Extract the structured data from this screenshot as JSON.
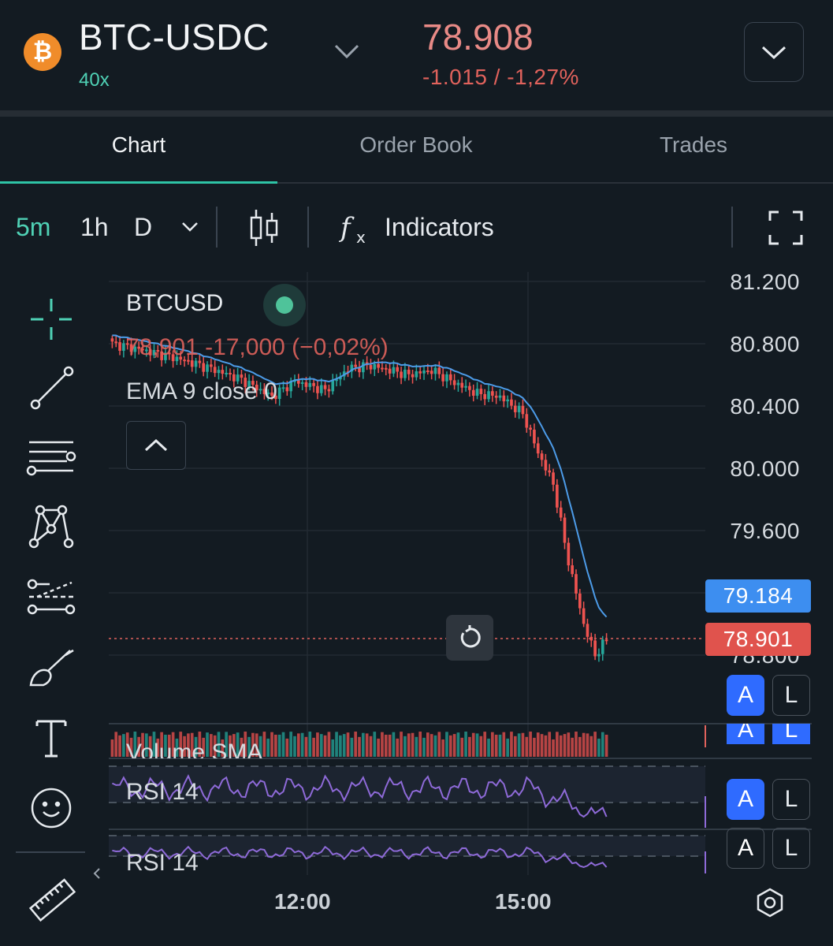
{
  "header": {
    "coin_glyph": "₿",
    "pair": "BTC-USDC",
    "leverage": "40x",
    "price": "78.908",
    "change": "-1.015 / -1,27%"
  },
  "tabs": [
    {
      "label": "Chart",
      "active": true
    },
    {
      "label": "Order Book",
      "active": false
    },
    {
      "label": "Trades",
      "active": false
    }
  ],
  "toolbar": {
    "intervals": [
      "5m",
      "1h",
      "D"
    ],
    "active_interval": "5m",
    "indicators_label": "Indicators"
  },
  "chart": {
    "symbol": "BTCUSD",
    "ohlc_line": "78,901  -17,000 (−0,02%)",
    "ema_label": "EMA 9 close 0",
    "volume_label": "Volume SMA",
    "rsi_label": "RSI 14",
    "rsi_label_2": "RSI 14",
    "price_levels": [
      "81.200",
      "80.800",
      "80.400",
      "80.000",
      "79.600",
      "78.800"
    ],
    "ema_badge": "79.184",
    "last_badge": "78.901",
    "time_labels": [
      "12:00",
      "15:00"
    ],
    "auto_label": "A",
    "log_label": "L",
    "colors": {
      "up": "#26a69a",
      "down": "#ef5350",
      "ema": "#4c9be8",
      "rsi": "#8e6ad8",
      "accent": "#4fd1b5"
    }
  }
}
